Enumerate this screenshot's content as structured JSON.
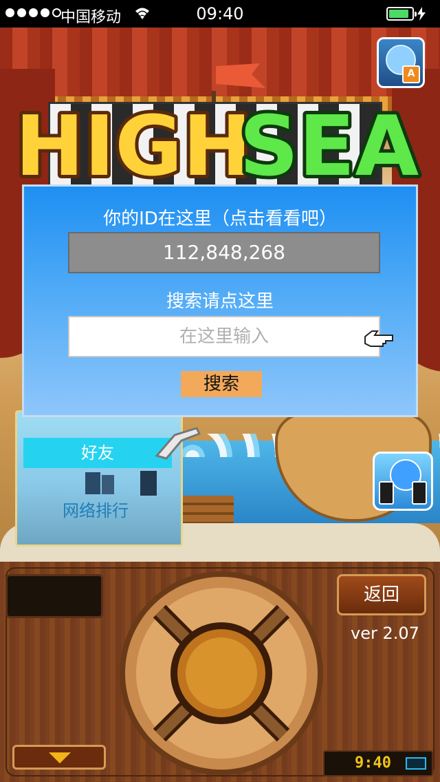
{
  "status_bar": {
    "carrier": "中国移动",
    "time": "09:40",
    "signal_bars": 4
  },
  "dialog": {
    "id_title": "你的ID在这里（点击看看吧）",
    "user_id": "112,848,268",
    "search_title": "搜索请点这里",
    "search_placeholder": "在这里输入",
    "search_button": "搜索"
  },
  "side_panel": {
    "friends_label": "好友",
    "ranking_label": "网络排行"
  },
  "controls": {
    "back_label": "返回",
    "version": "ver 2.07",
    "game_clock": "9:40"
  },
  "logo": {
    "text_left": "HIGH",
    "text_right": "SEA"
  },
  "colors": {
    "dialog_top": "#1e8ff2",
    "friends_tab": "#25d3f0",
    "search_button": "#f3a95a",
    "battery_green": "#4cd964"
  }
}
